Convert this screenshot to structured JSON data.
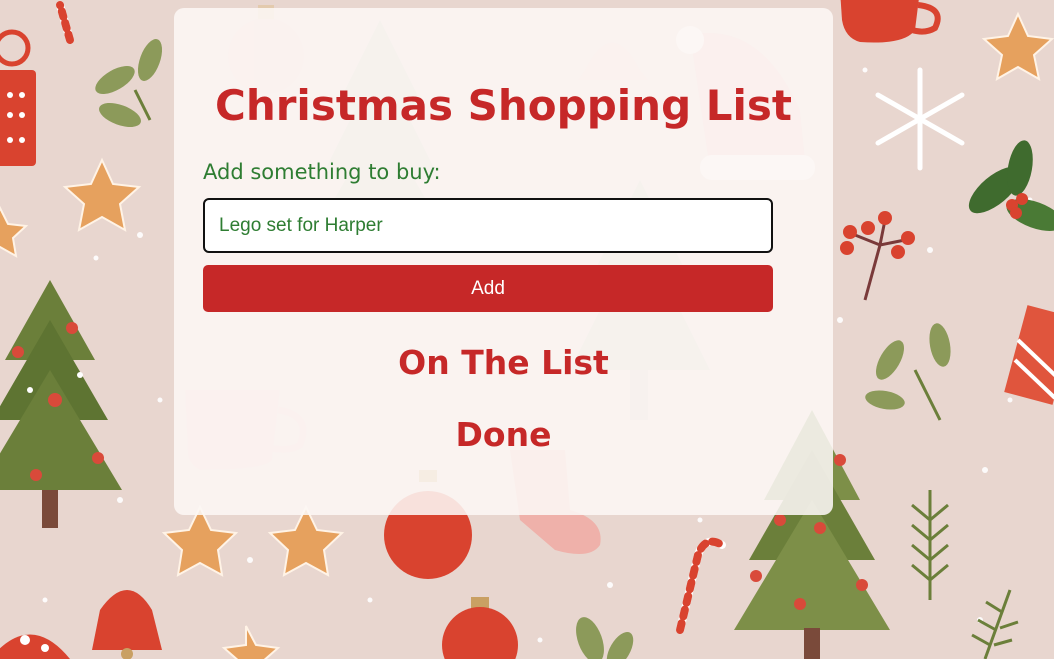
{
  "page": {
    "title": "Christmas Shopping List"
  },
  "form": {
    "label": "Add something to buy:",
    "input_value": "Lego set for Harper",
    "button_label": "Add"
  },
  "sections": {
    "on_the_list": "On The List",
    "done": "Done"
  },
  "colors": {
    "accent_red": "#c62828",
    "label_green": "#2e7d32",
    "background": "#e8d6cf",
    "tree_green": "#6b7f3a",
    "gingerbread": "#e6a15e"
  },
  "background": {
    "motif": "christmas-pattern",
    "icons": [
      "christmas-tree-icon",
      "ornament-icon",
      "gingerbread-star-icon",
      "candy-cane-icon",
      "snowflake-icon",
      "santa-hat-icon",
      "bell-icon",
      "gift-icon",
      "mug-icon",
      "holly-icon",
      "stocking-icon",
      "mistletoe-icon"
    ]
  }
}
